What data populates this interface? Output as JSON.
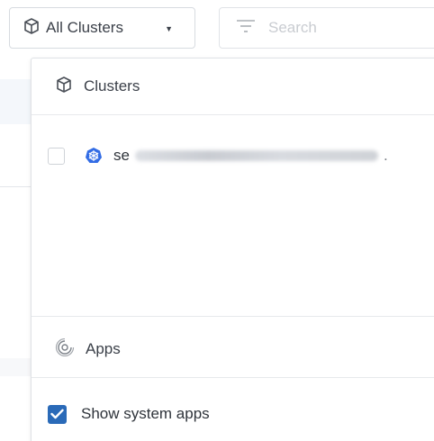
{
  "toolbar": {
    "cluster_select": {
      "label": "All Clusters",
      "icon": "cube-icon",
      "caret": "▼"
    },
    "search": {
      "placeholder": "Search",
      "icon": "filter-icon",
      "value": ""
    }
  },
  "dropdown": {
    "clusters_section": {
      "title": "Clusters",
      "icon": "cube-icon",
      "items": [
        {
          "name_visible": "se",
          "name_trailing": ".",
          "selected": false,
          "icon": "kubernetes-icon"
        }
      ]
    },
    "apps_section": {
      "title": "Apps",
      "icon": "apps-icon"
    },
    "system_apps": {
      "label": "Show system apps",
      "checked": true
    }
  },
  "colors": {
    "accent": "#2a6ab8",
    "kubernetes": "#326ce5",
    "border": "#dfe2e6",
    "text": "#3b4049"
  }
}
